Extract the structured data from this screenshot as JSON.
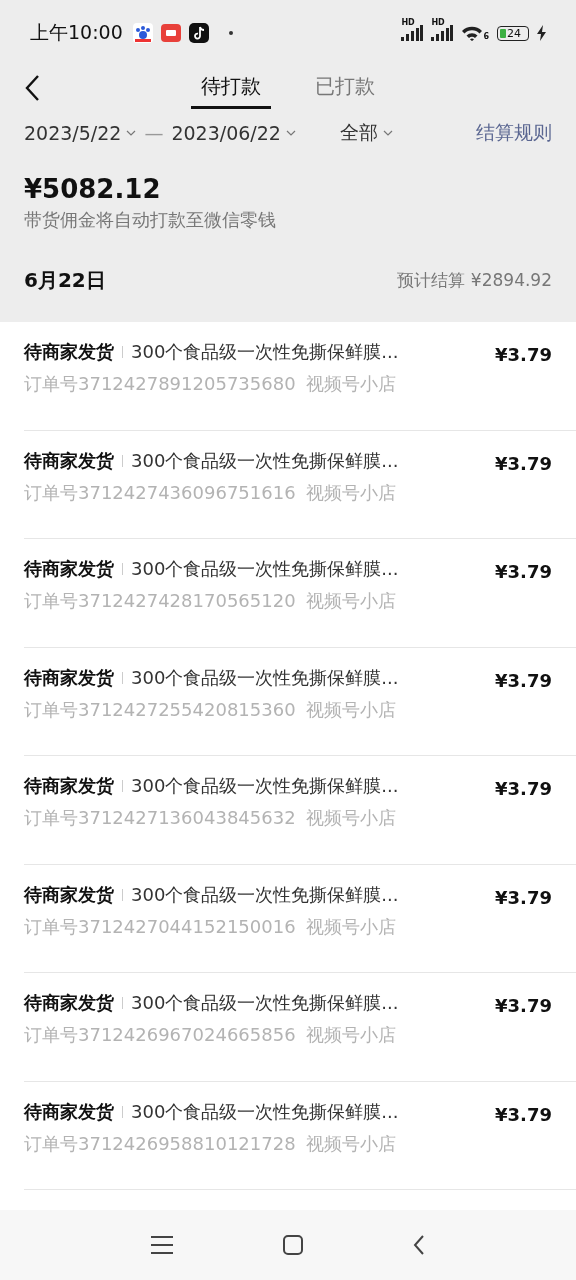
{
  "status_bar": {
    "time": "上午10:00",
    "signal_labels": [
      "HD",
      "HD"
    ],
    "wifi_band": "6",
    "battery": "24"
  },
  "tabs": [
    {
      "label": "待打款",
      "selected": true
    },
    {
      "label": "已打款",
      "selected": false
    }
  ],
  "filters": {
    "date_from": "2023/5/22",
    "date_separator": "—",
    "date_to": "2023/06/22",
    "category": "全部",
    "rules_link": "结算规则"
  },
  "summary": {
    "amount": "¥5082.12",
    "note": "带货佣金将自动打款至微信零钱"
  },
  "date_group": {
    "date": "6月22日",
    "estimate": "预计结算 ¥2894.92"
  },
  "orders": [
    {
      "status": "待商家发货",
      "title": "300个食品级一次性免撕保鲜膜...",
      "order_no": "订单号3712427891205735680",
      "shop": "视频号小店",
      "amount": "¥3.79"
    },
    {
      "status": "待商家发货",
      "title": "300个食品级一次性免撕保鲜膜...",
      "order_no": "订单号3712427436096751616",
      "shop": "视频号小店",
      "amount": "¥3.79"
    },
    {
      "status": "待商家发货",
      "title": "300个食品级一次性免撕保鲜膜...",
      "order_no": "订单号3712427428170565120",
      "shop": "视频号小店",
      "amount": "¥3.79"
    },
    {
      "status": "待商家发货",
      "title": "300个食品级一次性免撕保鲜膜...",
      "order_no": "订单号3712427255420815360",
      "shop": "视频号小店",
      "amount": "¥3.79"
    },
    {
      "status": "待商家发货",
      "title": "300个食品级一次性免撕保鲜膜...",
      "order_no": "订单号3712427136043845632",
      "shop": "视频号小店",
      "amount": "¥3.79"
    },
    {
      "status": "待商家发货",
      "title": "300个食品级一次性免撕保鲜膜...",
      "order_no": "订单号3712427044152150016",
      "shop": "视频号小店",
      "amount": "¥3.79"
    },
    {
      "status": "待商家发货",
      "title": "300个食品级一次性免撕保鲜膜...",
      "order_no": "订单号3712426967024665856",
      "shop": "视频号小店",
      "amount": "¥3.79"
    },
    {
      "status": "待商家发货",
      "title": "300个食品级一次性免撕保鲜膜...",
      "order_no": "订单号3712426958810121728",
      "shop": "视频号小店",
      "amount": "¥3.79"
    }
  ]
}
